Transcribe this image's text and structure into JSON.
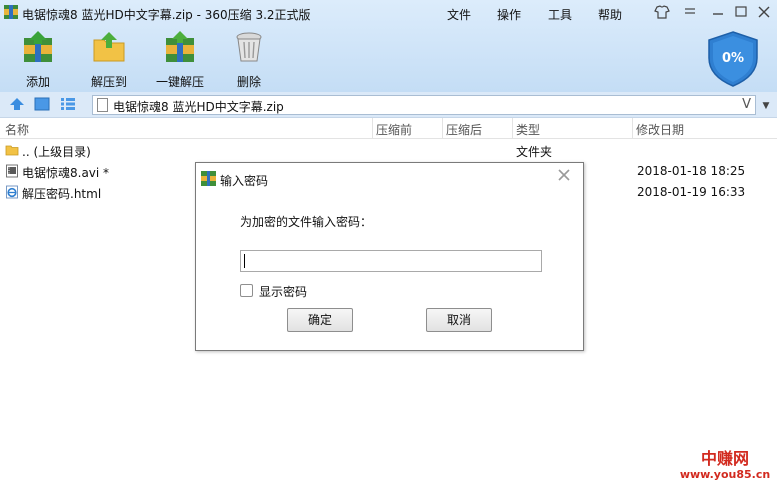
{
  "window": {
    "title": "电锯惊魂8 蓝光HD中文字幕.zip - 360压缩 3.2正式版",
    "menu": [
      "文件",
      "操作",
      "工具",
      "帮助"
    ]
  },
  "toolbar": {
    "add_label": "添加",
    "extract_to_label": "解压到",
    "one_click_extract_label": "一键解压",
    "delete_label": "删除"
  },
  "security_badge": {
    "value": "0%"
  },
  "address": {
    "path": "电锯惊魂8 蓝光HD中文字幕.zip",
    "v_button": "V"
  },
  "columns": [
    "名称",
    "压缩前",
    "压缩后",
    "类型",
    "修改日期"
  ],
  "files": [
    {
      "name": ".. (上级目录)",
      "type": "文件夹",
      "date": "",
      "icon": "folder-icon"
    },
    {
      "name": "电锯惊魂8.avi *",
      "type": "",
      "date": "2018-01-18 18:25",
      "icon": "video-file-icon"
    },
    {
      "name": "解压密码.html",
      "type": "",
      "date": "2018-01-19 16:33",
      "icon": "html-file-icon"
    }
  ],
  "dialog": {
    "title": "输入密码",
    "prompt": "为加密的文件输入密码：",
    "password_value": "",
    "show_password_label": "显示密码",
    "show_password_checked": false,
    "ok_label": "确定",
    "cancel_label": "取消"
  },
  "watermark": {
    "top": "中赚网",
    "bottom": "www.you85.cn"
  },
  "colors": {
    "accent": "#2f7fd1",
    "toolbar_bg": "#cfe4f8",
    "watermark": "#d22a1f"
  }
}
